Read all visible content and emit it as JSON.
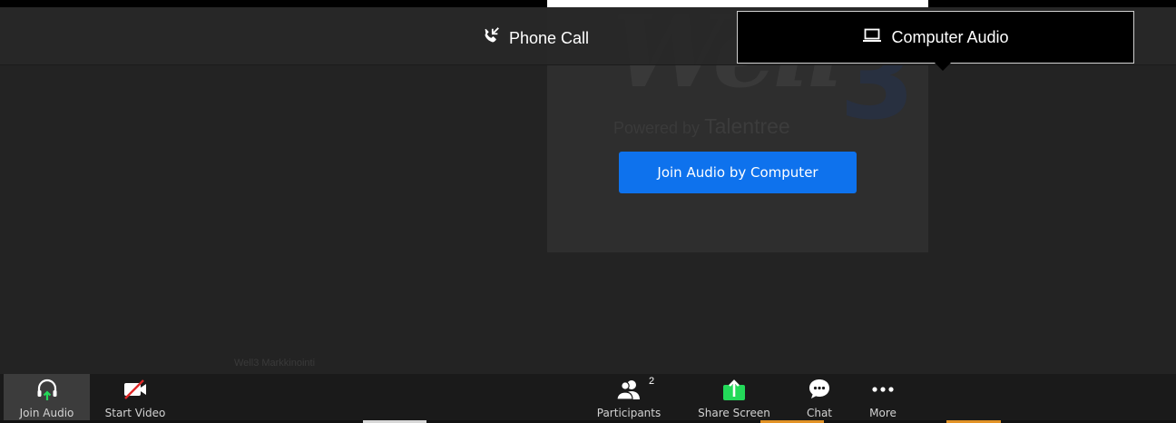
{
  "header": {
    "tabs": [
      {
        "label": "Phone Call",
        "icon": "phone-icon",
        "selected": false
      },
      {
        "label": "Computer Audio",
        "icon": "laptop-icon",
        "selected": true
      }
    ]
  },
  "dialog": {
    "logo": {
      "word": "Well",
      "numeral": "3",
      "powered_prefix": "Powered by",
      "powered_brand": "Talentree"
    },
    "join_button_label": "Join Audio by Computer"
  },
  "video": {
    "participant_name": "Well3 Markkinointi"
  },
  "toolbar": {
    "items": [
      {
        "label": "Join Audio",
        "icon": "headphones-icon"
      },
      {
        "label": "Start Video",
        "icon": "video-off-icon"
      },
      {
        "label": "Participants",
        "icon": "participants-icon",
        "count": "2"
      },
      {
        "label": "Share Screen",
        "icon": "share-screen-icon"
      },
      {
        "label": "Chat",
        "icon": "chat-icon"
      },
      {
        "label": "More",
        "icon": "more-icon"
      }
    ]
  },
  "colors": {
    "accent_blue": "#0e72ed",
    "share_green": "#23d959",
    "background": "#232323",
    "toolbar": "#1a1a1a"
  }
}
